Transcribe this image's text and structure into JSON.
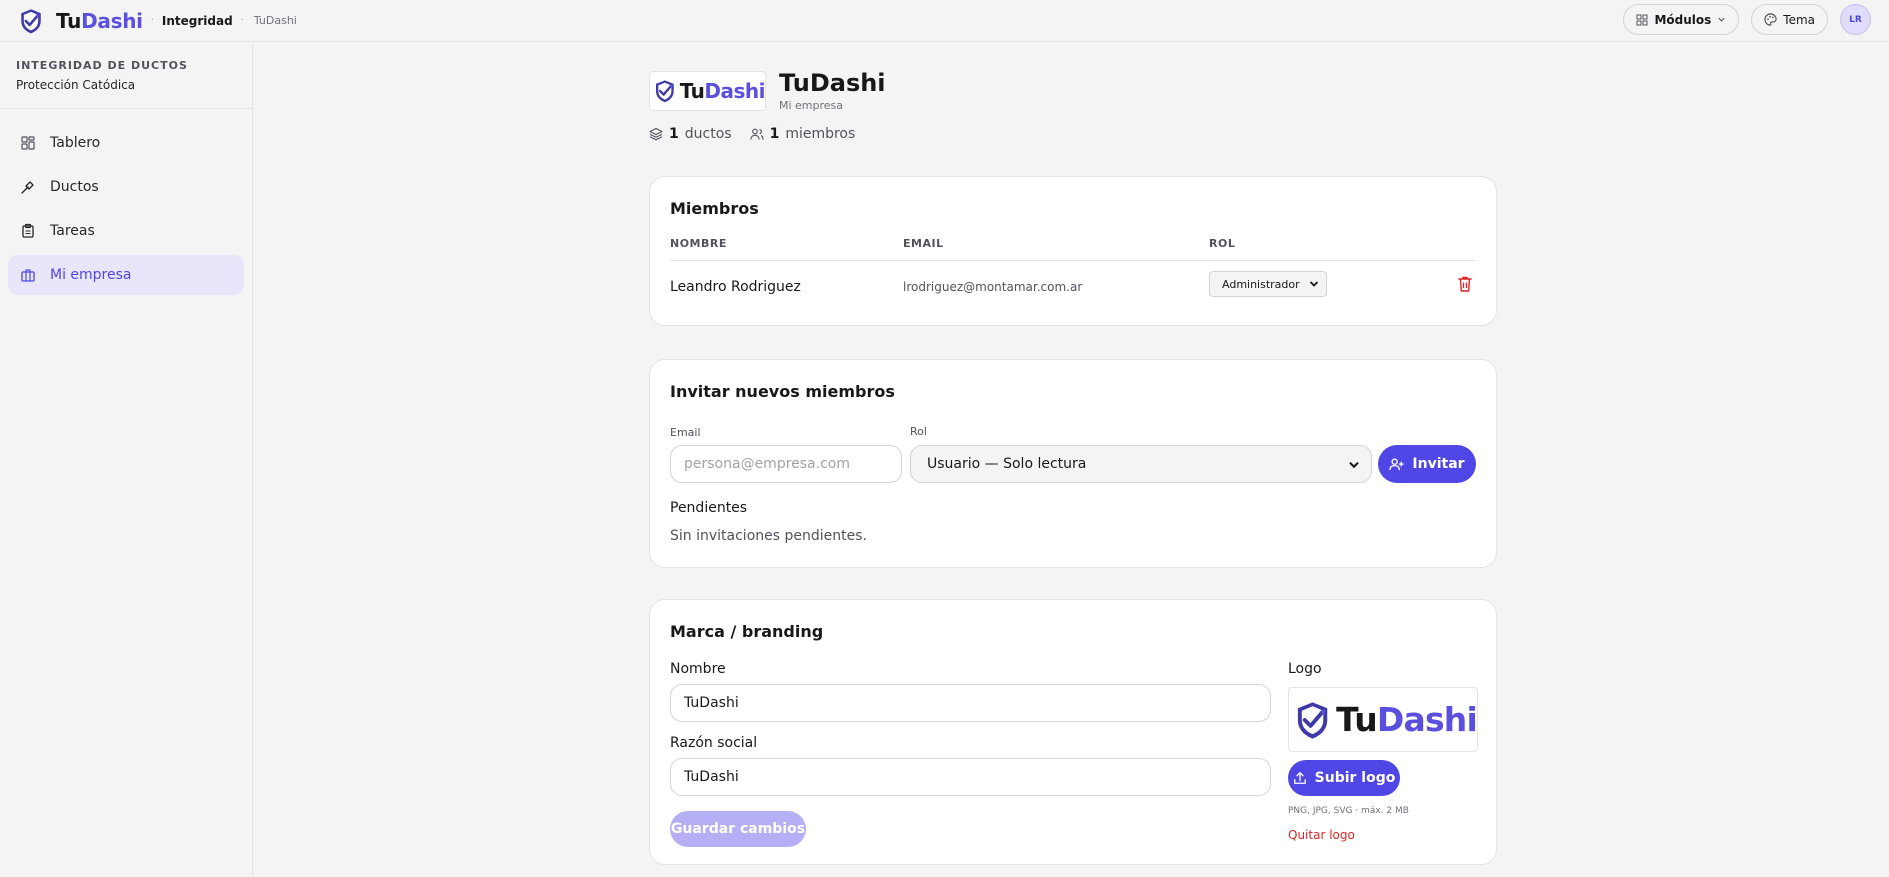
{
  "topbar": {
    "brand_tu": "Tu",
    "brand_dashi": "Dashi",
    "crumb_sep": "·",
    "crumb_main": "Integridad",
    "crumb_sub": "TuDashi",
    "modules_label": "Módulos",
    "theme_label": "Tema",
    "avatar_initials": "LR"
  },
  "sidebar": {
    "title": "INTEGRIDAD DE DUCTOS",
    "subtitle": "Protección Catódica",
    "items": [
      {
        "label": "Tablero",
        "icon": "grid-icon",
        "active": false
      },
      {
        "label": "Ductos",
        "icon": "pipe-icon",
        "active": false
      },
      {
        "label": "Tareas",
        "icon": "clipboard-icon",
        "active": false
      },
      {
        "label": "Mi empresa",
        "icon": "briefcase-icon",
        "active": true
      }
    ]
  },
  "company": {
    "logo_tu": "Tu",
    "logo_dashi": "Dashi",
    "name": "TuDashi",
    "subtitle": "Mi empresa",
    "ducts_count": "1",
    "ducts_label": "ductos",
    "members_count": "1",
    "members_label": "miembros"
  },
  "members": {
    "title": "Miembros",
    "headers": [
      "NOMBRE",
      "EMAIL",
      "ROL"
    ],
    "rows": [
      {
        "name": "Leandro Rodriguez",
        "email": "lrodriguez@montamar.com.ar",
        "role": "Administrador"
      }
    ]
  },
  "invite": {
    "title": "Invitar nuevos miembros",
    "email_label": "Email",
    "email_placeholder": "persona@empresa.com",
    "role_label": "Rol",
    "role_value": "Usuario — Solo lectura",
    "invite_button": "Invitar",
    "pending_title": "Pendientes",
    "pending_empty": "Sin invitaciones pendientes."
  },
  "branding": {
    "title": "Marca / branding",
    "name_label": "Nombre",
    "name_value": "TuDashi",
    "legal_label": "Razón social",
    "legal_value": "TuDashi",
    "save_button": "Guardar cambios",
    "logo_label": "Logo",
    "logo_tu": "Tu",
    "logo_dashi": "Dashi",
    "upload_button": "Subir logo",
    "upload_hint": "PNG, JPG, SVG · máx. 2 MB",
    "remove_logo": "Quitar logo"
  },
  "colors": {
    "accent": "#4f46e5",
    "accent_light": "#e9e6fc",
    "danger": "#dc2626"
  }
}
